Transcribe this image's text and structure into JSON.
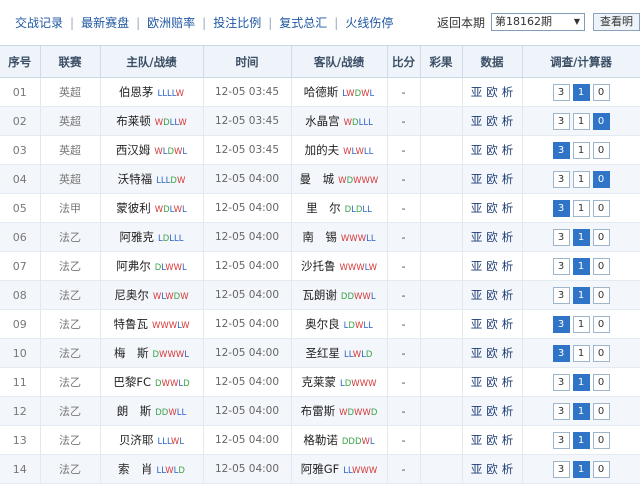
{
  "toolbar": {
    "links": [
      "交战记录",
      "最新赛盘",
      "欧洲赔率",
      "投注比例",
      "复式总汇",
      "火线伤停"
    ],
    "back_label": "返回本期",
    "period": "第18162期",
    "view_label": "查看明"
  },
  "columns": [
    "序号",
    "联赛",
    "主队/战绩",
    "时间",
    "客队/战绩",
    "比分",
    "彩果",
    "数据",
    "调查/计算器"
  ],
  "data_links": [
    "亚",
    "欧",
    "析"
  ],
  "rows": [
    {
      "seq": "01",
      "league": "英超",
      "home": "伯恩茅",
      "home_form": "LLLLW",
      "time": "12-05 03:45",
      "away": "哈德斯",
      "away_form": "LWDWL",
      "score": "-",
      "calc": [
        "3",
        "1",
        "0"
      ],
      "on": [
        false,
        true,
        false
      ]
    },
    {
      "seq": "02",
      "league": "英超",
      "home": "布莱顿",
      "home_form": "WDLLW",
      "time": "12-05 03:45",
      "away": "水晶宫",
      "away_form": "WDLLL",
      "score": "-",
      "calc": [
        "3",
        "1",
        "0"
      ],
      "on": [
        false,
        false,
        true
      ]
    },
    {
      "seq": "03",
      "league": "英超",
      "home": "西汉姆",
      "home_form": "WLDWL",
      "time": "12-05 03:45",
      "away": "加的夫",
      "away_form": "WLWLL",
      "score": "-",
      "calc": [
        "3",
        "1",
        "0"
      ],
      "on": [
        true,
        false,
        false
      ]
    },
    {
      "seq": "04",
      "league": "英超",
      "home": "沃特福",
      "home_form": "LLLDW",
      "time": "12-05 04:00",
      "away": "曼　城",
      "away_form": "WDWWW",
      "score": "-",
      "calc": [
        "3",
        "1",
        "0"
      ],
      "on": [
        false,
        false,
        true
      ]
    },
    {
      "seq": "05",
      "league": "法甲",
      "home": "蒙彼利",
      "home_form": "WDLWL",
      "time": "12-05 04:00",
      "away": "里　尔",
      "away_form": "DLDLL",
      "score": "-",
      "calc": [
        "3",
        "1",
        "0"
      ],
      "on": [
        true,
        false,
        false
      ]
    },
    {
      "seq": "06",
      "league": "法乙",
      "home": "阿雅克",
      "home_form": "LDLLL",
      "time": "12-05 04:00",
      "away": "南　锡",
      "away_form": "WWWLL",
      "score": "-",
      "calc": [
        "3",
        "1",
        "0"
      ],
      "on": [
        false,
        true,
        false
      ]
    },
    {
      "seq": "07",
      "league": "法乙",
      "home": "阿弗尔",
      "home_form": "DLWWL",
      "time": "12-05 04:00",
      "away": "沙托鲁",
      "away_form": "WWWLW",
      "score": "-",
      "calc": [
        "3",
        "1",
        "0"
      ],
      "on": [
        false,
        true,
        false
      ]
    },
    {
      "seq": "08",
      "league": "法乙",
      "home": "尼奥尔",
      "home_form": "WLWDW",
      "time": "12-05 04:00",
      "away": "瓦朗谢",
      "away_form": "DDWWL",
      "score": "-",
      "calc": [
        "3",
        "1",
        "0"
      ],
      "on": [
        false,
        true,
        false
      ]
    },
    {
      "seq": "09",
      "league": "法乙",
      "home": "特鲁瓦",
      "home_form": "WWWLW",
      "time": "12-05 04:00",
      "away": "奥尔良",
      "away_form": "LDWLL",
      "score": "-",
      "calc": [
        "3",
        "1",
        "0"
      ],
      "on": [
        true,
        false,
        false
      ]
    },
    {
      "seq": "10",
      "league": "法乙",
      "home": "梅　斯",
      "home_form": "DWWWL",
      "time": "12-05 04:00",
      "away": "圣红星",
      "away_form": "LLWLD",
      "score": "-",
      "calc": [
        "3",
        "1",
        "0"
      ],
      "on": [
        true,
        false,
        false
      ]
    },
    {
      "seq": "11",
      "league": "法乙",
      "home": "巴黎FC",
      "home_form": "DWWLD",
      "time": "12-05 04:00",
      "away": "克莱蒙",
      "away_form": "LDWWW",
      "score": "-",
      "calc": [
        "3",
        "1",
        "0"
      ],
      "on": [
        false,
        true,
        false
      ]
    },
    {
      "seq": "12",
      "league": "法乙",
      "home": "朗　斯",
      "home_form": "DDWLL",
      "time": "12-05 04:00",
      "away": "布雷斯",
      "away_form": "WDWWD",
      "score": "-",
      "calc": [
        "3",
        "1",
        "0"
      ],
      "on": [
        false,
        true,
        false
      ]
    },
    {
      "seq": "13",
      "league": "法乙",
      "home": "贝济耶",
      "home_form": "LLLWL",
      "time": "12-05 04:00",
      "away": "格勒诺",
      "away_form": "DDDWL",
      "score": "-",
      "calc": [
        "3",
        "1",
        "0"
      ],
      "on": [
        false,
        true,
        false
      ]
    },
    {
      "seq": "14",
      "league": "法乙",
      "home": "索　肖",
      "home_form": "LLWLD",
      "time": "12-05 04:00",
      "away": "阿雅GF",
      "away_form": "LLWWW",
      "score": "-",
      "calc": [
        "3",
        "1",
        "0"
      ],
      "on": [
        false,
        true,
        false
      ]
    }
  ],
  "colors": {
    "win": "#d63b3b",
    "draw": "#3aa34a",
    "loss": "#2d62c8",
    "selected": "#2f74c6"
  }
}
